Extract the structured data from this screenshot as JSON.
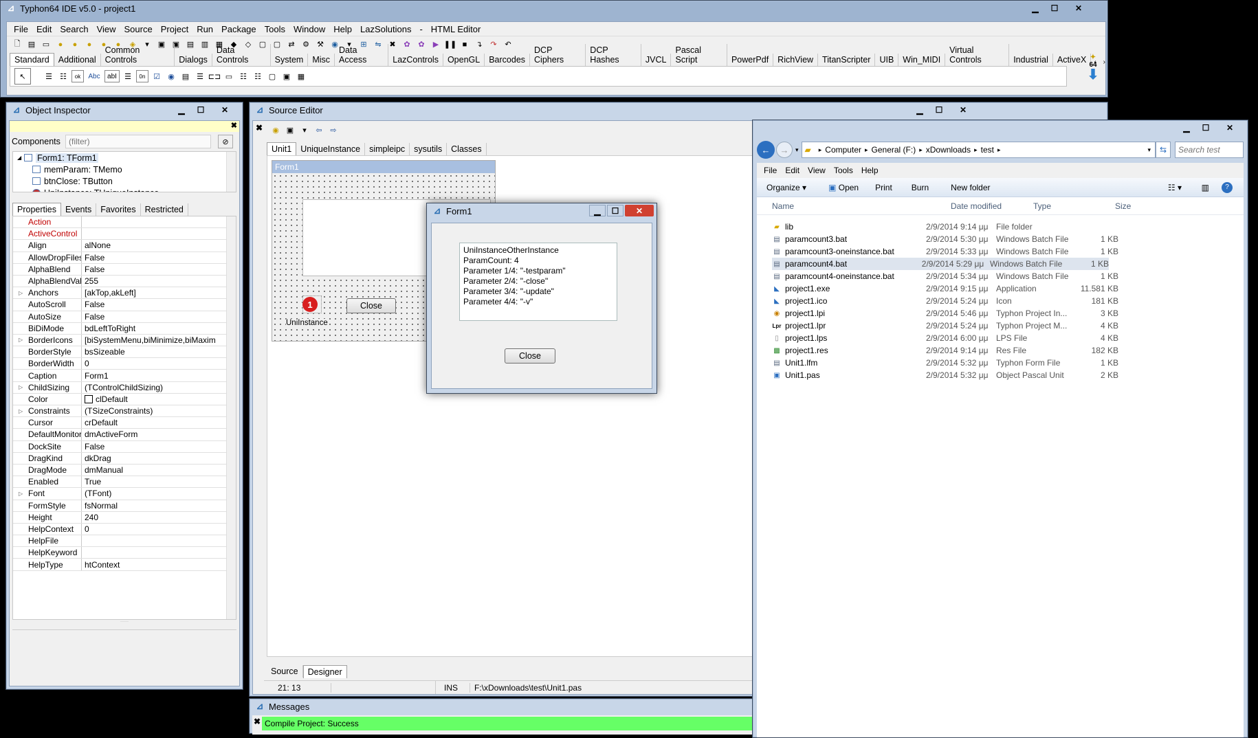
{
  "ide": {
    "title": "Typhon64 IDE v5.0 - project1",
    "menu": [
      "File",
      "Edit",
      "Search",
      "View",
      "Source",
      "Project",
      "Run",
      "Package",
      "Tools",
      "Window",
      "Help",
      "LazSolutions",
      "-",
      "HTML Editor"
    ],
    "palette_tabs": [
      "Standard",
      "Additional",
      "Common Controls",
      "Dialogs",
      "Data Controls",
      "System",
      "Misc",
      "Data Access",
      "LazControls",
      "OpenGL",
      "Barcodes",
      "DCP Ciphers",
      "DCP Hashes",
      "JVCL",
      "Pascal Script",
      "PowerPdf",
      "RichView",
      "TitanScripter",
      "UIB",
      "Win_MIDI",
      "Virtual Controls",
      "Industrial",
      "ActiveX"
    ],
    "badge": "64"
  },
  "inspector": {
    "title": "Object Inspector",
    "components_label": "Components",
    "filter_placeholder": "(filter)",
    "tree": [
      "Form1: TForm1",
      "memParam: TMemo",
      "btnClose: TButton",
      "UniInstance: TUniqueInstance"
    ],
    "tabs": [
      "Properties",
      "Events",
      "Favorites",
      "Restricted"
    ],
    "properties": [
      {
        "name": "Action",
        "value": "",
        "red": true,
        "exp": false
      },
      {
        "name": "ActiveControl",
        "value": "",
        "red": true,
        "exp": false
      },
      {
        "name": "Align",
        "value": "alNone",
        "red": false,
        "exp": false
      },
      {
        "name": "AllowDropFiles",
        "value": "False",
        "red": false,
        "exp": false
      },
      {
        "name": "AlphaBlend",
        "value": "False",
        "red": false,
        "exp": false
      },
      {
        "name": "AlphaBlendValue",
        "value": "255",
        "red": false,
        "exp": false
      },
      {
        "name": "Anchors",
        "value": "[akTop,akLeft]",
        "red": false,
        "exp": true
      },
      {
        "name": "AutoScroll",
        "value": "False",
        "red": false,
        "exp": false
      },
      {
        "name": "AutoSize",
        "value": "False",
        "red": false,
        "exp": false
      },
      {
        "name": "BiDiMode",
        "value": "bdLeftToRight",
        "red": false,
        "exp": false
      },
      {
        "name": "BorderIcons",
        "value": "[biSystemMenu,biMinimize,biMaxim",
        "red": false,
        "exp": true
      },
      {
        "name": "BorderStyle",
        "value": "bsSizeable",
        "red": false,
        "exp": false
      },
      {
        "name": "BorderWidth",
        "value": "0",
        "red": false,
        "exp": false
      },
      {
        "name": "Caption",
        "value": "Form1",
        "red": false,
        "exp": false
      },
      {
        "name": "ChildSizing",
        "value": "(TControlChildSizing)",
        "red": false,
        "exp": true
      },
      {
        "name": "Color",
        "value": "clDefault",
        "red": false,
        "exp": false,
        "swatch": true
      },
      {
        "name": "Constraints",
        "value": "(TSizeConstraints)",
        "red": false,
        "exp": true
      },
      {
        "name": "Cursor",
        "value": "crDefault",
        "red": false,
        "exp": false
      },
      {
        "name": "DefaultMonitor",
        "value": "dmActiveForm",
        "red": false,
        "exp": false
      },
      {
        "name": "DockSite",
        "value": "False",
        "red": false,
        "exp": false
      },
      {
        "name": "DragKind",
        "value": "dkDrag",
        "red": false,
        "exp": false
      },
      {
        "name": "DragMode",
        "value": "dmManual",
        "red": false,
        "exp": false
      },
      {
        "name": "Enabled",
        "value": "True",
        "red": false,
        "exp": false
      },
      {
        "name": "Font",
        "value": "(TFont)",
        "red": false,
        "exp": true
      },
      {
        "name": "FormStyle",
        "value": "fsNormal",
        "red": false,
        "exp": false
      },
      {
        "name": "Height",
        "value": "240",
        "red": false,
        "exp": false
      },
      {
        "name": "HelpContext",
        "value": "0",
        "red": false,
        "exp": false
      },
      {
        "name": "HelpFile",
        "value": "",
        "red": false,
        "exp": false
      },
      {
        "name": "HelpKeyword",
        "value": "",
        "red": false,
        "exp": false
      },
      {
        "name": "HelpType",
        "value": "htContext",
        "red": false,
        "exp": false
      }
    ]
  },
  "editor": {
    "title": "Source Editor",
    "tabs": [
      "Unit1",
      "UniqueInstance",
      "simpleipc",
      "sysutils",
      "Classes"
    ],
    "designer_form_title": "Form1",
    "designer_button": "Close",
    "designer_component": "UniInstance",
    "badge_number": "1",
    "bottom_tabs": [
      "Source",
      "Designer"
    ],
    "status_pos": "21: 13",
    "status_mode": "INS",
    "status_file": "F:\\xDownloads\\test\\Unit1.pas"
  },
  "dialog": {
    "title": "Form1",
    "memo_lines": [
      "UniInstanceOtherInstance",
      "ParamCount: 4",
      "Parameter 1/4: \"-testparam\"",
      "Parameter 2/4: \"-close\"",
      "Parameter 3/4: \"-update\"",
      "Parameter 4/4: \"-v\""
    ],
    "button": "Close"
  },
  "messages": {
    "title": "Messages",
    "line": "Compile Project: Success"
  },
  "explorer": {
    "breadcrumb": [
      "Computer",
      "General (F:)",
      "xDownloads",
      "test"
    ],
    "search_placeholder": "Search test",
    "menu": [
      "File",
      "Edit",
      "View",
      "Tools",
      "Help"
    ],
    "toolbar": [
      "Organize",
      "Open",
      "Print",
      "Burn",
      "New folder"
    ],
    "columns": [
      "Name",
      "Date modified",
      "Type",
      "Size"
    ],
    "files": [
      {
        "name": "lib",
        "date": "2/9/2014 9:14 μμ",
        "type": "File folder",
        "size": "",
        "icon": "folder"
      },
      {
        "name": "paramcount3.bat",
        "date": "2/9/2014 5:30 μμ",
        "type": "Windows Batch File",
        "size": "1 KB",
        "icon": "bat"
      },
      {
        "name": "paramcount3-oneinstance.bat",
        "date": "2/9/2014 5:33 μμ",
        "type": "Windows Batch File",
        "size": "1 KB",
        "icon": "bat"
      },
      {
        "name": "paramcount4.bat",
        "date": "2/9/2014 5:29 μμ",
        "type": "Windows Batch File",
        "size": "1 KB",
        "icon": "bat",
        "selected": true
      },
      {
        "name": "paramcount4-oneinstance.bat",
        "date": "2/9/2014 5:34 μμ",
        "type": "Windows Batch File",
        "size": "1 KB",
        "icon": "bat"
      },
      {
        "name": "project1.exe",
        "date": "2/9/2014 9:15 μμ",
        "type": "Application",
        "size": "11.581 KB",
        "icon": "exe"
      },
      {
        "name": "project1.ico",
        "date": "2/9/2014 5:24 μμ",
        "type": "Icon",
        "size": "181 KB",
        "icon": "exe"
      },
      {
        "name": "project1.lpi",
        "date": "2/9/2014 5:46 μμ",
        "type": "Typhon Project In...",
        "size": "3 KB",
        "icon": "lpi"
      },
      {
        "name": "project1.lpr",
        "date": "2/9/2014 5:24 μμ",
        "type": "Typhon Project M...",
        "size": "4 KB",
        "icon": "lpr"
      },
      {
        "name": "project1.lps",
        "date": "2/9/2014 6:00 μμ",
        "type": "LPS File",
        "size": "4 KB",
        "icon": "doc"
      },
      {
        "name": "project1.res",
        "date": "2/9/2014 9:14 μμ",
        "type": "Res File",
        "size": "182 KB",
        "icon": "res"
      },
      {
        "name": "Unit1.lfm",
        "date": "2/9/2014 5:32 μμ",
        "type": "Typhon Form File",
        "size": "1 KB",
        "icon": "lfm"
      },
      {
        "name": "Unit1.pas",
        "date": "2/9/2014 5:32 μμ",
        "type": "Object Pascal Unit",
        "size": "2 KB",
        "icon": "pas"
      }
    ]
  },
  "colors": {
    "window_frame": "#c8d6e8",
    "success_bar": "#66ff66",
    "property_red": "#c00000",
    "badge_red": "#d81e1e"
  }
}
